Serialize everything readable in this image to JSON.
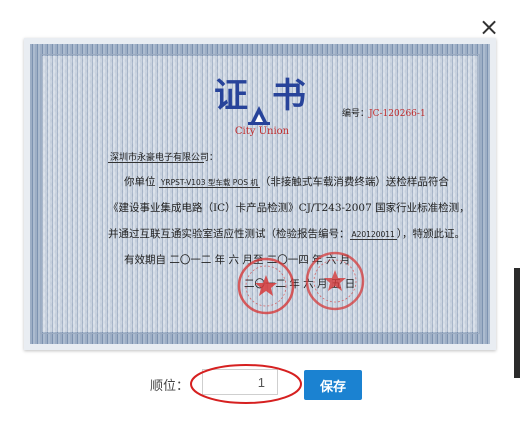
{
  "dialog": {
    "close_glyph": "×"
  },
  "certificate": {
    "title": "证书",
    "logo_text": "City Union",
    "number_label": "编号：",
    "number_value": "JC-120266-1",
    "company": "深圳市永豪电子有限公司：",
    "line1_prefix": "你单位",
    "line1_model": "YRPST-V103 型车载 POS 机",
    "line1_suffix": "（非接触式车载消费终端）送检样品符合",
    "line2": "《建设事业集成电路（IC）卡产品检测》CJ/T243-2007 国家行业标准检测，",
    "line3_prefix": "并通过互联互通实验室适应性测试（检验报告编号：",
    "line3_report": "A20120011",
    "line3_suffix": "），特颁此证。",
    "line4": "有效期自 二〇一二 年 六 月至 二〇一四 年 六 月",
    "line5": "二〇一二 年 六 月 五 日",
    "seal_colors": {
      "red": "#d63a3a"
    }
  },
  "form": {
    "order_label": "顺位：",
    "order_value": "1",
    "save_label": "保存"
  },
  "colors": {
    "accent": "#1b82d1",
    "highlight": "#d62020"
  }
}
